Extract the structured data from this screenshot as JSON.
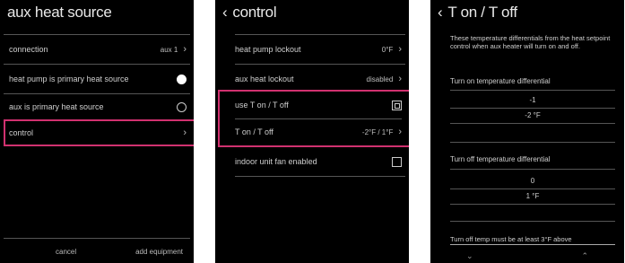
{
  "screen1": {
    "title": "aux heat source",
    "connection_label": "connection",
    "connection_value": "aux 1",
    "option1_label": "heat pump is primary heat source",
    "option2_label": "aux is primary heat source",
    "control_label": "control",
    "cancel_label": "cancel",
    "add_label": "add equipment"
  },
  "screen2": {
    "title": "control",
    "lockout_label": "heat pump lockout",
    "lockout_value": "0°F",
    "aux_lockout_label": "aux heat lockout",
    "aux_lockout_value": "disabled",
    "use_ton_label": "use T on / T off",
    "ton_label": "T on / T off",
    "ton_value": "-2°F / 1°F",
    "indoor_label": "indoor unit fan enabled"
  },
  "screen3": {
    "title": "T on / T off",
    "description": "These temperature differentials from the heat setpoint control when aux heater will turn on and off.",
    "turn_on_label": "Turn on temperature differential",
    "turn_on_prev": "-1",
    "turn_on_value": "-2 °F",
    "turn_off_label": "Turn off temperature differential",
    "turn_off_prev": "0",
    "turn_off_value": "1 °F",
    "warning": "Turn off temp must be at least 3°F above"
  },
  "accent": "#d0316f"
}
